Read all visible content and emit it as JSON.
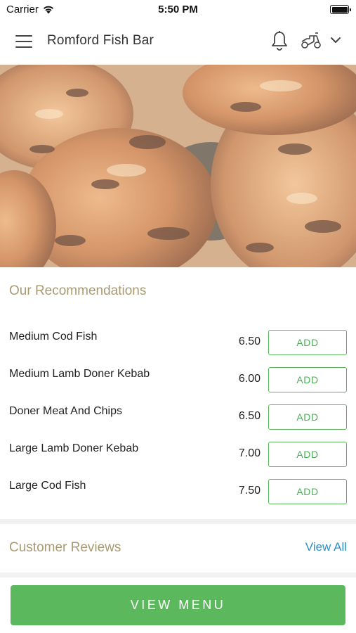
{
  "status_bar": {
    "carrier": "Carrier",
    "time": "5:50 PM",
    "icons": [
      "wifi-icon",
      "battery-icon"
    ]
  },
  "nav": {
    "title": "Romford Fish Bar",
    "icons": [
      "menu-icon",
      "bell-icon",
      "delivery-scooter-icon",
      "chevron-down-icon"
    ]
  },
  "hero": {
    "image": "grilled chicken photo"
  },
  "recommendations": {
    "title": "Our Recommendations",
    "items": [
      {
        "name": "Medium Cod Fish",
        "price": "6.50",
        "button": "ADD"
      },
      {
        "name": "Medium Lamb Doner Kebab",
        "price": "6.00",
        "button": "ADD"
      },
      {
        "name": "Doner Meat And Chips",
        "price": "6.50",
        "button": "ADD"
      },
      {
        "name": "Large Lamb Doner Kebab",
        "price": "7.00",
        "button": "ADD"
      },
      {
        "name": "Large Cod Fish",
        "price": "7.50",
        "button": "ADD"
      }
    ]
  },
  "reviews": {
    "title": "Customer Reviews",
    "view_all": "View All"
  },
  "footer": {
    "view_menu": "VIEW MENU"
  },
  "colors": {
    "accent_green": "#5cb85c",
    "section_title": "#a89a72",
    "link_blue": "#2c8fc9"
  }
}
